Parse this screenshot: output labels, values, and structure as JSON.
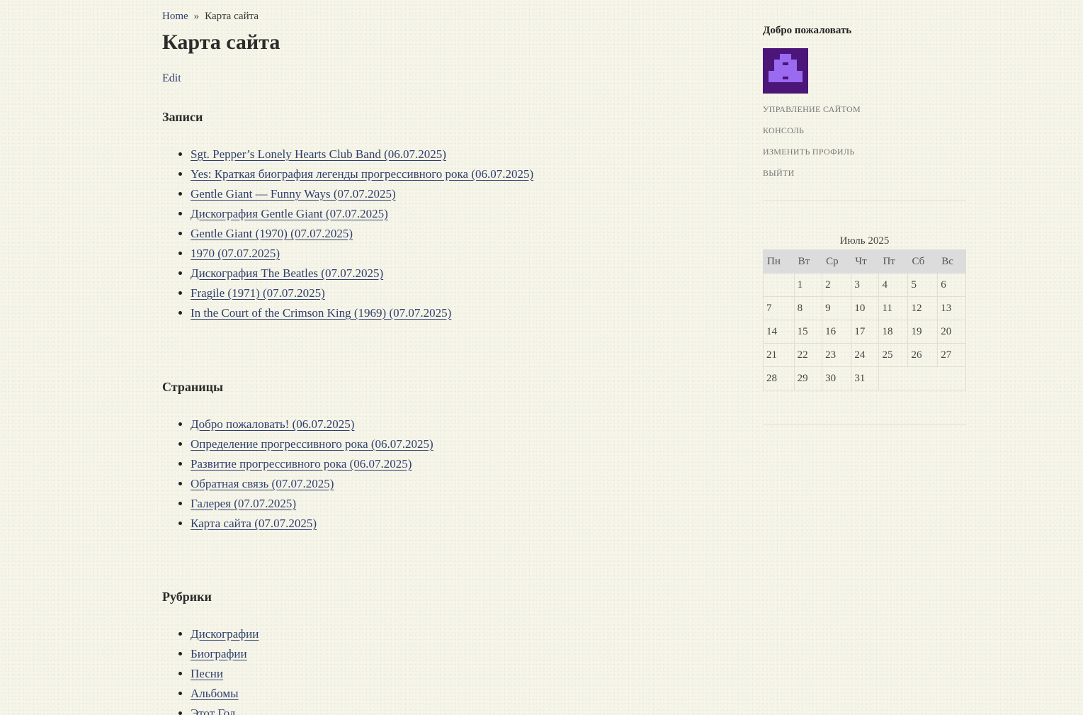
{
  "breadcrumb": {
    "home": "Home",
    "separator": "»",
    "current": "Карта сайта"
  },
  "page": {
    "title": "Карта сайта",
    "edit": "Edit"
  },
  "sections": {
    "posts": {
      "heading": "Записи",
      "items": [
        "Sgt. Pepper’s Lonely Hearts Club Band (06.07.2025)",
        "Yes: Краткая биография легенды прогрессивного рока (06.07.2025)",
        "Gentle Giant — Funny Ways (07.07.2025)",
        "Дискография Gentle Giant (07.07.2025)",
        "Gentle Giant (1970) (07.07.2025)",
        "1970 (07.07.2025)",
        "Дискография The Beatles (07.07.2025)",
        "Fragile (1971) (07.07.2025)",
        "In the Court of the Crimson King (1969) (07.07.2025)"
      ]
    },
    "pages": {
      "heading": "Страницы",
      "items": [
        "Добро пожаловать! (06.07.2025)",
        "Определение прогрессивного рока (06.07.2025)",
        "Развитие прогрессивного рока (06.07.2025)",
        "Обратная связь (07.07.2025)",
        "Галерея (07.07.2025)",
        "Карта сайта (07.07.2025)"
      ]
    },
    "categories": {
      "heading": "Рубрики",
      "items": [
        "Дискографии",
        "Биографии",
        "Песни",
        "Альбомы",
        "Этот Год"
      ]
    }
  },
  "sidebar": {
    "welcome_title": "Добро пожаловать",
    "avatar_colors": {
      "background": "#4b1579",
      "figure": "#9a6af0"
    },
    "admin_links": [
      "управление сайтом",
      "консоль",
      "изменить профиль",
      "выйти"
    ],
    "calendar": {
      "caption": "Июль 2025",
      "weekdays": [
        "Пн",
        "Вт",
        "Ср",
        "Чт",
        "Пт",
        "Сб",
        "Вс"
      ],
      "weeks": [
        [
          "",
          "1",
          "2",
          "3",
          "4",
          "5",
          "6"
        ],
        [
          "7",
          "8",
          "9",
          "10",
          "11",
          "12",
          "13"
        ],
        [
          "14",
          "15",
          "16",
          "17",
          "18",
          "19",
          "20"
        ],
        [
          "21",
          "22",
          "23",
          "24",
          "25",
          "26",
          "27"
        ],
        [
          "28",
          "29",
          "30",
          "31",
          "",
          "",
          ""
        ]
      ]
    }
  }
}
